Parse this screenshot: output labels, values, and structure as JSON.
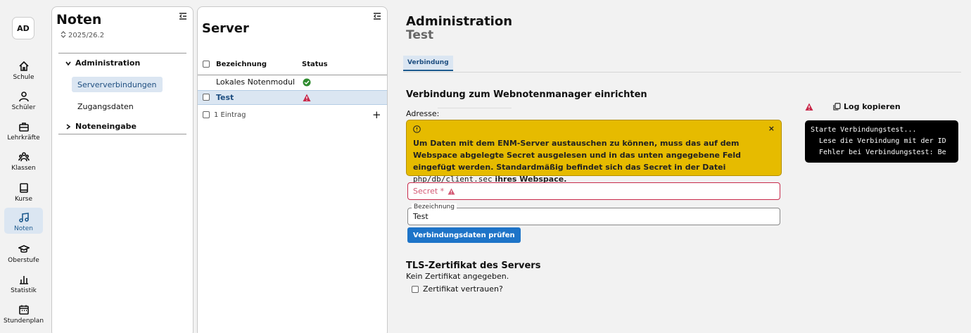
{
  "nav": {
    "avatar": "AD",
    "items": [
      {
        "label": "Schule",
        "icon": "home-icon"
      },
      {
        "label": "Schüler",
        "icon": "user-icon"
      },
      {
        "label": "Lehrkräfte",
        "icon": "briefcase-icon"
      },
      {
        "label": "Klassen",
        "icon": "group-icon"
      },
      {
        "label": "Kurse",
        "icon": "book-icon"
      },
      {
        "label": "Noten",
        "icon": "music-note-icon",
        "active": true
      },
      {
        "label": "Oberstufe",
        "icon": "graduation-cap-icon"
      },
      {
        "label": "Statistik",
        "icon": "bar-chart-icon"
      },
      {
        "label": "Stundenplan",
        "icon": "calendar-icon"
      }
    ]
  },
  "noten_panel": {
    "title": "Noten",
    "year": "2025/26.2",
    "groups": {
      "administration": "Administration",
      "serververbindungen": "Serververbindungen",
      "zugangsdaten": "Zugangsdaten",
      "noteneingabe": "Noteneingabe"
    }
  },
  "server_panel": {
    "title": "Server",
    "col_name": "Bezeichnung",
    "col_status": "Status",
    "rows": [
      {
        "name": "Lokales Notenmodul",
        "status": "ok"
      },
      {
        "name": "Test",
        "status": "warning"
      }
    ],
    "count": "1 Eintrag",
    "add": "+"
  },
  "main": {
    "title": "Administration",
    "subtitle": "Test",
    "tab": "Verbindung",
    "section_title": "Verbindung zum Webnotenmanager einrichten",
    "address_label": "Adresse:",
    "warning": {
      "text_before": "Um Daten mit dem ENM-Server austauschen zu können, muss das auf dem Webspace abgelegte Secret ausgelesen und in das unten angegebene Feld eingefügt werden. Standardmäßig befindet sich das Secret in der Datei ",
      "code": "php/db/client.sec",
      "text_after": " ihres Webspace.",
      "close": "×"
    },
    "secret_placeholder": "Secret *",
    "bezeichnung_label": "Bezeichnung",
    "bezeichnung_value": "Test",
    "check_button": "Verbindungsdaten prüfen",
    "tls_title": "TLS-Zertifikat des Servers",
    "tls_text": "Kein Zertifikat angegeben.",
    "trust_label": "Zertifikat vertrauen?",
    "log_copy": "Log kopieren",
    "log_lines": [
      "Starte Verbindungstest...",
      "  Lese die Verbindung mit der ID",
      "  Fehler bei Verbindungstest: Be"
    ]
  },
  "colors": {
    "accent": "#1e74c8",
    "selection": "#dbe6f2",
    "warning_bg": "#e6bb00",
    "error": "#c8294a",
    "ok": "#2e8b2e"
  }
}
